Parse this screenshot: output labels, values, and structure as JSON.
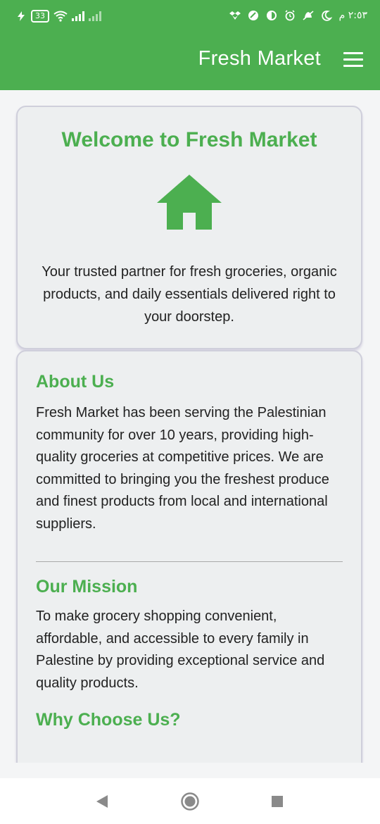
{
  "status_bar": {
    "battery": "33",
    "time": "٢:٥٣ م",
    "icons": [
      "charging-bolt-icon",
      "wifi-icon",
      "signal-icon",
      "signal-no-service-icon",
      "dropbox-icon",
      "vpn-icon",
      "data-saver-icon",
      "alarm-icon",
      "mute-icon",
      "moon-icon"
    ]
  },
  "app_bar": {
    "title": "Fresh Market",
    "menu_icon": "hamburger-menu-icon",
    "background": "#4caf50"
  },
  "welcome": {
    "title": "Welcome to Fresh Market",
    "icon": "home-icon",
    "text": "Your trusted partner for fresh groceries, organic products, and daily essentials delivered right to your doorstep."
  },
  "about": {
    "title": "About Us",
    "text": "Fresh Market has been serving the Palestinian community for over 10 years, providing high-quality groceries at competitive prices. We are committed to bringing you the freshest produce and finest products from local and international suppliers."
  },
  "mission": {
    "title": "Our Mission",
    "text": "To make grocery shopping convenient, affordable, and accessible to every family in Palestine by providing exceptional service and quality products."
  },
  "why": {
    "title": "Why Choose Us?"
  },
  "nav_bar": {
    "icons": [
      "back-triangle-icon",
      "home-circle-icon",
      "recents-square-icon"
    ]
  },
  "colors": {
    "accent": "#4caf50",
    "card_bg": "#edeff0",
    "page_bg": "#f4f5f6"
  }
}
